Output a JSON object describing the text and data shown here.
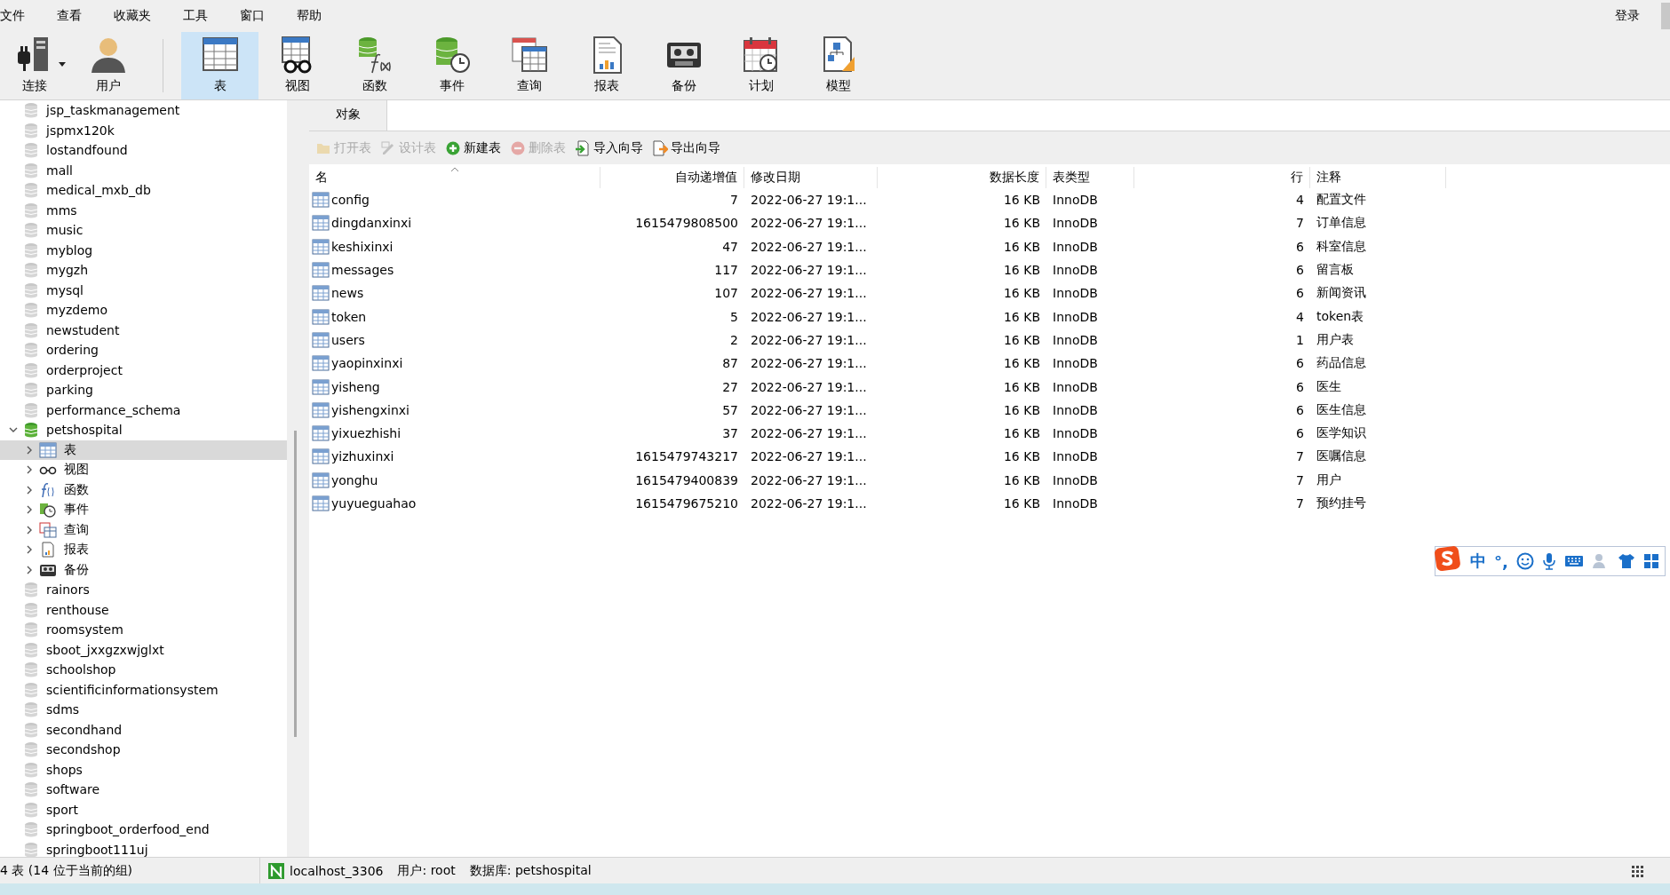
{
  "menu": [
    {
      "label": "文件"
    },
    {
      "label": "查看"
    },
    {
      "label": "收藏夹"
    },
    {
      "label": "工具"
    },
    {
      "label": "窗口"
    },
    {
      "label": "帮助"
    }
  ],
  "login": "登录",
  "toolbar": [
    {
      "kind": "connection",
      "label": "连接",
      "selected": false,
      "dropdown": true
    },
    {
      "kind": "user",
      "label": "用户",
      "selected": false,
      "dropdown": false
    },
    {
      "kind": "table",
      "label": "表",
      "selected": true,
      "dropdown": false
    },
    {
      "kind": "view",
      "label": "视图",
      "selected": false,
      "dropdown": false
    },
    {
      "kind": "function",
      "label": "函数",
      "selected": false,
      "dropdown": false
    },
    {
      "kind": "event",
      "label": "事件",
      "selected": false,
      "dropdown": false
    },
    {
      "kind": "query",
      "label": "查询",
      "selected": false,
      "dropdown": false
    },
    {
      "kind": "report",
      "label": "报表",
      "selected": false,
      "dropdown": false
    },
    {
      "kind": "backup",
      "label": "备份",
      "selected": false,
      "dropdown": false
    },
    {
      "kind": "schedule",
      "label": "计划",
      "selected": false,
      "dropdown": false
    },
    {
      "kind": "model",
      "label": "模型",
      "selected": false,
      "dropdown": false
    }
  ],
  "sidebar": {
    "tree": [
      {
        "kind": "database",
        "label": "jsp_taskmanagement",
        "open": false,
        "selected": false
      },
      {
        "kind": "database",
        "label": "jspmx120k",
        "open": false,
        "selected": false
      },
      {
        "kind": "database",
        "label": "lostandfound",
        "open": false,
        "selected": false
      },
      {
        "kind": "database",
        "label": "mall",
        "open": false,
        "selected": false
      },
      {
        "kind": "database",
        "label": "medical_mxb_db",
        "open": false,
        "selected": false
      },
      {
        "kind": "database",
        "label": "mms",
        "open": false,
        "selected": false
      },
      {
        "kind": "database",
        "label": "music",
        "open": false,
        "selected": false
      },
      {
        "kind": "database",
        "label": "myblog",
        "open": false,
        "selected": false
      },
      {
        "kind": "database",
        "label": "mygzh",
        "open": false,
        "selected": false
      },
      {
        "kind": "database",
        "label": "mysql",
        "open": false,
        "selected": false
      },
      {
        "kind": "database",
        "label": "myzdemo",
        "open": false,
        "selected": false
      },
      {
        "kind": "database",
        "label": "newstudent",
        "open": false,
        "selected": false
      },
      {
        "kind": "database",
        "label": "ordering",
        "open": false,
        "selected": false
      },
      {
        "kind": "database",
        "label": "orderproject",
        "open": false,
        "selected": false
      },
      {
        "kind": "database",
        "label": "parking",
        "open": false,
        "selected": false
      },
      {
        "kind": "database",
        "label": "performance_schema",
        "open": false,
        "selected": false
      },
      {
        "kind": "database",
        "label": "petshospital",
        "open": true,
        "selected": false,
        "expanded": true,
        "children": [
          {
            "kind": "table",
            "label": "表",
            "selected": true,
            "expanded": false
          },
          {
            "kind": "view",
            "label": "视图",
            "selected": false,
            "expanded": false
          },
          {
            "kind": "function",
            "label": "函数",
            "selected": false,
            "expanded": false
          },
          {
            "kind": "event",
            "label": "事件",
            "selected": false,
            "expanded": false
          },
          {
            "kind": "query",
            "label": "查询",
            "selected": false,
            "expanded": false
          },
          {
            "kind": "report",
            "label": "报表",
            "selected": false,
            "expanded": false
          },
          {
            "kind": "backup",
            "label": "备份",
            "selected": false,
            "expanded": false
          }
        ]
      },
      {
        "kind": "database",
        "label": "rainors",
        "open": false,
        "selected": false
      },
      {
        "kind": "database",
        "label": "renthouse",
        "open": false,
        "selected": false
      },
      {
        "kind": "database",
        "label": "roomsystem",
        "open": false,
        "selected": false
      },
      {
        "kind": "database",
        "label": "sboot_jxxgzxwjglxt",
        "open": false,
        "selected": false
      },
      {
        "kind": "database",
        "label": "schoolshop",
        "open": false,
        "selected": false
      },
      {
        "kind": "database",
        "label": "scientificinformationsystem",
        "open": false,
        "selected": false
      },
      {
        "kind": "database",
        "label": "sdms",
        "open": false,
        "selected": false
      },
      {
        "kind": "database",
        "label": "secondhand",
        "open": false,
        "selected": false
      },
      {
        "kind": "database",
        "label": "secondshop",
        "open": false,
        "selected": false
      },
      {
        "kind": "database",
        "label": "shops",
        "open": false,
        "selected": false
      },
      {
        "kind": "database",
        "label": "software",
        "open": false,
        "selected": false
      },
      {
        "kind": "database",
        "label": "sport",
        "open": false,
        "selected": false
      },
      {
        "kind": "database",
        "label": "springboot_orderfood_end",
        "open": false,
        "selected": false
      },
      {
        "kind": "database",
        "label": "springboot111uj",
        "open": false,
        "selected": false
      }
    ]
  },
  "object_tab": {
    "label": "对象",
    "selected": true
  },
  "actions": [
    {
      "kind": "open",
      "label": "打开表",
      "disabled": true
    },
    {
      "kind": "design",
      "label": "设计表",
      "disabled": true
    },
    {
      "kind": "new",
      "label": "新建表",
      "disabled": false
    },
    {
      "kind": "delete",
      "label": "删除表",
      "disabled": true
    },
    {
      "kind": "import",
      "label": "导入向导",
      "disabled": false
    },
    {
      "kind": "export",
      "label": "导出向导",
      "disabled": false
    }
  ],
  "table": {
    "columns": [
      {
        "label": "名",
        "sorted": true
      },
      {
        "label": "自动递增值",
        "sorted": false
      },
      {
        "label": "修改日期",
        "sorted": false
      },
      {
        "label": "数据长度",
        "sorted": false
      },
      {
        "label": "表类型",
        "sorted": false
      },
      {
        "label": "行",
        "sorted": false
      },
      {
        "label": "注释",
        "sorted": false
      }
    ],
    "rows": [
      [
        "config",
        "7",
        "2022-06-27 19:1...",
        "16 KB",
        "InnoDB",
        "4",
        "配置文件"
      ],
      [
        "dingdanxinxi",
        "1615479808500",
        "2022-06-27 19:1...",
        "16 KB",
        "InnoDB",
        "7",
        "订单信息"
      ],
      [
        "keshixinxi",
        "47",
        "2022-06-27 19:1...",
        "16 KB",
        "InnoDB",
        "6",
        "科室信息"
      ],
      [
        "messages",
        "117",
        "2022-06-27 19:1...",
        "16 KB",
        "InnoDB",
        "6",
        "留言板"
      ],
      [
        "news",
        "107",
        "2022-06-27 19:1...",
        "16 KB",
        "InnoDB",
        "6",
        "新闻资讯"
      ],
      [
        "token",
        "5",
        "2022-06-27 19:1...",
        "16 KB",
        "InnoDB",
        "4",
        "token表"
      ],
      [
        "users",
        "2",
        "2022-06-27 19:1...",
        "16 KB",
        "InnoDB",
        "1",
        "用户表"
      ],
      [
        "yaopinxinxi",
        "87",
        "2022-06-27 19:1...",
        "16 KB",
        "InnoDB",
        "6",
        "药品信息"
      ],
      [
        "yisheng",
        "27",
        "2022-06-27 19:1...",
        "16 KB",
        "InnoDB",
        "6",
        "医生"
      ],
      [
        "yishengxinxi",
        "57",
        "2022-06-27 19:1...",
        "16 KB",
        "InnoDB",
        "6",
        "医生信息"
      ],
      [
        "yixuezhishi",
        "37",
        "2022-06-27 19:1...",
        "16 KB",
        "InnoDB",
        "6",
        "医学知识"
      ],
      [
        "yizhuxinxi",
        "1615479743217",
        "2022-06-27 19:1...",
        "16 KB",
        "InnoDB",
        "7",
        "医嘱信息"
      ],
      [
        "yonghu",
        "1615479400839",
        "2022-06-27 19:1...",
        "16 KB",
        "InnoDB",
        "7",
        "用户"
      ],
      [
        "yuyueguahao",
        "1615479675210",
        "2022-06-27 19:1...",
        "16 KB",
        "InnoDB",
        "7",
        "预约挂号"
      ]
    ]
  },
  "ime_bar": [
    {
      "kind": "logo"
    },
    {
      "kind": "text",
      "label": "中"
    },
    {
      "kind": "text",
      "label": "°,"
    },
    {
      "kind": "emoji"
    },
    {
      "kind": "mic"
    },
    {
      "kind": "keyboard"
    },
    {
      "kind": "user"
    },
    {
      "kind": "shirt"
    },
    {
      "kind": "grid"
    }
  ],
  "status_bar": {
    "count": "4 表 (14 位于当前的组)",
    "connection": "localhost_3306",
    "user": "用户: root",
    "database": "数据库: petshospital"
  }
}
